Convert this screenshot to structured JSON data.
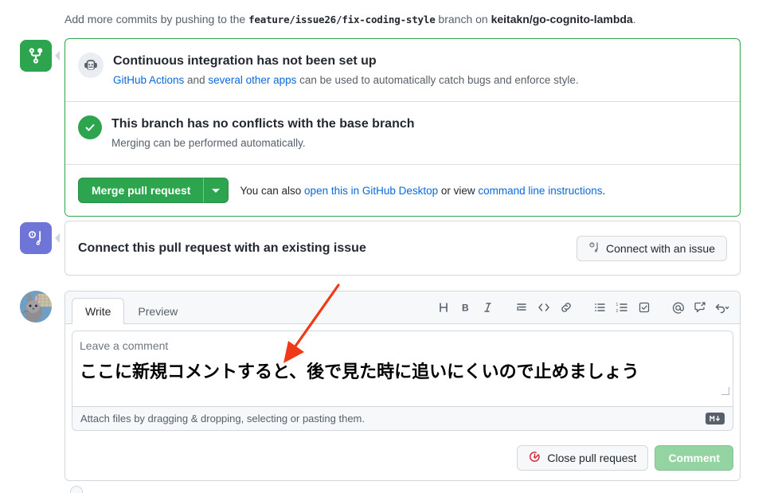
{
  "push_note": {
    "prefix": "Add more commits by pushing to the ",
    "branch": "feature/issue26/fix-coding-style",
    "middle": " branch on ",
    "repo": "keitakn/go-cognito-lambda",
    "suffix": "."
  },
  "merge_box": {
    "accent_color": "#2da44e",
    "ci": {
      "icon": "robot-icon",
      "title": "Continuous integration has not been set up",
      "sub_link1": "GitHub Actions",
      "sub_mid": " and ",
      "sub_link2": "several other apps",
      "sub_tail": " can be used to automatically catch bugs and enforce style."
    },
    "conflicts": {
      "icon": "check-circle-icon",
      "title": "This branch has no conflicts with the base branch",
      "sub": "Merging can be performed automatically."
    },
    "actions": {
      "merge_label": "Merge pull request",
      "caret_icon": "chevron-down-icon",
      "hint_prefix": "You can also ",
      "hint_link1": "open this in GitHub Desktop",
      "hint_mid": " or view ",
      "hint_link2": "command line instructions",
      "hint_suffix": "."
    }
  },
  "connect_box": {
    "title": "Connect this pull request with an existing issue",
    "button_label": "Connect with an issue",
    "button_icon": "cross-reference-icon"
  },
  "composer": {
    "avatar_name": "user-avatar",
    "tabs": [
      {
        "label": "Write",
        "active": true
      },
      {
        "label": "Preview",
        "active": false
      }
    ],
    "toolbar": [
      {
        "name": "heading-icon",
        "glyph": "H"
      },
      {
        "name": "bold-icon",
        "glyph": "B"
      },
      {
        "name": "italic-icon",
        "glyph": "I"
      },
      {
        "name": "quote-icon",
        "glyph": "≡"
      },
      {
        "name": "code-icon",
        "glyph": "<>"
      },
      {
        "name": "link-icon",
        "glyph": "🔗"
      },
      {
        "name": "unordered-list-icon",
        "glyph": "☰"
      },
      {
        "name": "ordered-list-icon",
        "glyph": "1."
      },
      {
        "name": "task-list-icon",
        "glyph": "☑"
      },
      {
        "name": "mention-icon",
        "glyph": "@"
      },
      {
        "name": "saved-reply-icon",
        "glyph": "↗"
      },
      {
        "name": "reply-icon",
        "glyph": "↩"
      }
    ],
    "textarea": {
      "placeholder": "Leave a comment",
      "value": "ここに新規コメントすると、後で見た時に追いにくいので止めましょう"
    },
    "attach_hint": "Attach files by dragging & dropping, selecting or pasting them.",
    "markdown_badge": "M↓",
    "close_button": "Close pull request",
    "close_icon": "issue-closed-icon",
    "comment_button": "Comment",
    "comment_button_color": "#94d3a2"
  },
  "annotation": {
    "arrow_color": "#f03a17",
    "name": "red-annotation-arrow"
  }
}
